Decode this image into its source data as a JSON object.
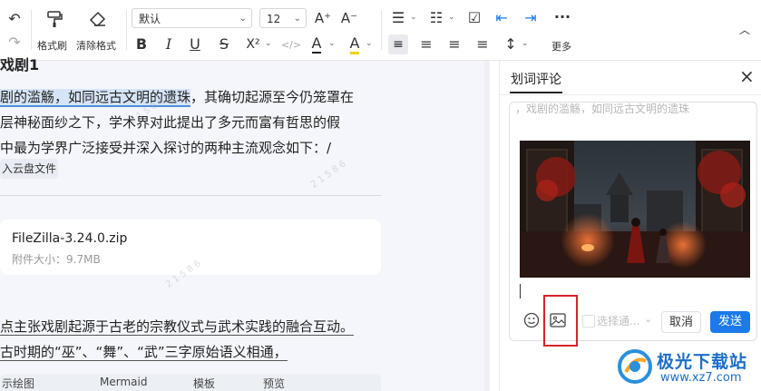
{
  "toolbar": {
    "format_brush_label": "格式刷",
    "clear_format_label": "清除格式",
    "font_family_value": "默认",
    "font_size_value": "12",
    "more_label": "更多",
    "superscript_label": "X²",
    "code_label": "</>",
    "font_color_label": "A",
    "highlight_label": "A",
    "grow_font_label": "A⁺",
    "shrink_font_label": "A⁻"
  },
  "document": {
    "heading_fragment": "戏剧1",
    "line1_highlighted": "剧的滥觞，如同远古文明的遗珠",
    "line1_rest": "，其确切起源至今仍笼罩在",
    "line2": "层神秘面纱之下，学术界对此提出了多元而富有哲思的假",
    "line3": "中最为学界广泛接受并深入探讨的两种主流观念如下：/",
    "cloud_tag": "入云盘文件",
    "file_name": "FileZilla-3.24.0.zip",
    "file_size": "附件大小：9.7MB",
    "line4": "点主张戏剧起源于古老的宗教仪式与武术实践的融合互动。",
    "line5": "古时期的“巫”、“舞”、“武”三字原始语义相通，",
    "code_bar_left": "示绘图",
    "code_bar_lang": "Mermaid",
    "code_bar_template": "模板",
    "code_bar_preview": "预览"
  },
  "panel": {
    "tab_label": "划词评论",
    "close_icon": "×",
    "quoted_text": "，戏剧的滥觞，如同远古文明的遗珠",
    "notify_placeholder": "选择通...",
    "cancel_label": "取消",
    "send_label": "发送"
  },
  "watermark": {
    "brand": "极光下载站",
    "url": "www.xz7.com"
  },
  "colors": {
    "accent": "#1c7ae8",
    "highlight_box": "#d8232a",
    "selection": "#d6e4f7"
  }
}
